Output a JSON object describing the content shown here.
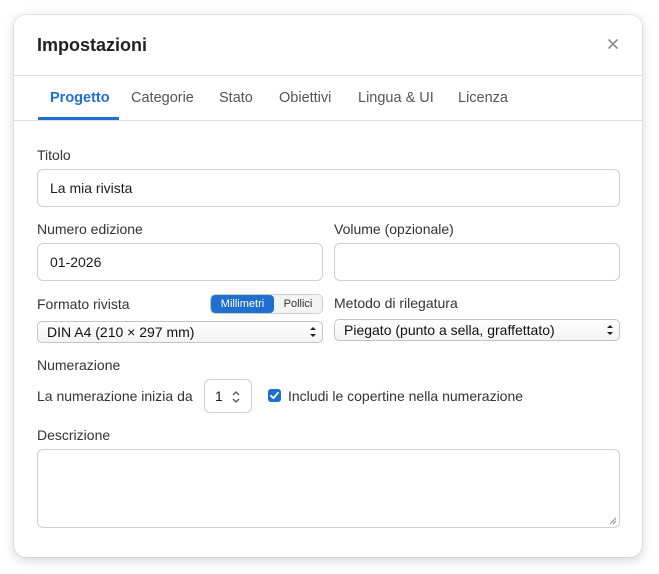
{
  "dialog": {
    "title": "Impostazioni"
  },
  "tabs": [
    {
      "label": "Progetto",
      "active": true
    },
    {
      "label": "Categorie"
    },
    {
      "label": "Stato"
    },
    {
      "label": "Obiettivi"
    },
    {
      "label": "Lingua & UI"
    },
    {
      "label": "Licenza"
    }
  ],
  "form": {
    "title_label": "Titolo",
    "title_value": "La mia rivista",
    "issue_label": "Numero edizione",
    "issue_value": "01-2026",
    "volume_label": "Volume (opzionale)",
    "volume_value": "",
    "format_label": "Formato rivista",
    "unit_options": [
      "Millimetri",
      "Pollici"
    ],
    "unit_selected": "Millimetri",
    "format_value": "DIN A4 (210 × 297 mm)",
    "binding_label": "Metodo di rilegatura",
    "binding_value": "Piegato (punto a sella, graffettato)",
    "numbering_heading": "Numerazione",
    "numbering_start_label": "La numerazione inizia da",
    "numbering_start_value": "1",
    "include_covers_label": "Includi le copertine nella numerazione",
    "include_covers_checked": true,
    "description_label": "Descrizione",
    "description_value": ""
  },
  "colors": {
    "accent": "#1f6fd1",
    "border": "#cfcfcf"
  },
  "icons": {
    "close": "close-icon",
    "select": "chevron-up-down-icon",
    "stepper": "stepper-arrows-icon",
    "check": "check-icon"
  }
}
